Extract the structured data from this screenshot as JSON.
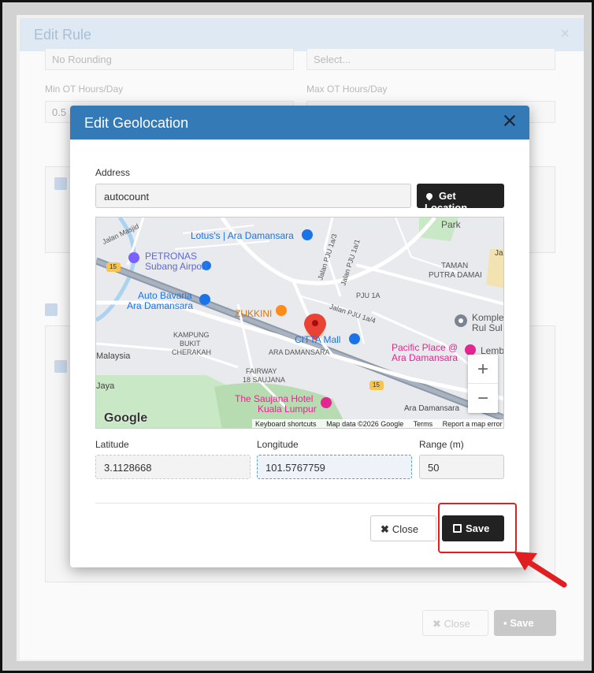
{
  "background": {
    "title": "Edit Rule",
    "rounding_select": "No Rounding",
    "select_placeholder": "Select...",
    "min_ot_label": "Min OT Hours/Day",
    "max_ot_label": "Max OT Hours/Day",
    "min_ot_value": "0.5",
    "close_label": "Close",
    "save_label": "Save"
  },
  "modal": {
    "title": "Edit Geolocation",
    "address_label": "Address",
    "address_value": "autocount",
    "get_location_label": "Get Location",
    "latitude_label": "Latitude",
    "latitude_value": "3.1128668",
    "longitude_label": "Longitude",
    "longitude_value": "101.5767759",
    "range_label": "Range (m)",
    "range_value": "50",
    "close_label": "Close",
    "save_label": "Save"
  },
  "map": {
    "places": {
      "lotus": "Lotus's | Ara Damansara",
      "petronas": "PETRONAS Subang Airport",
      "petronas_line2": "Subang Airport",
      "petronas_line1": "PETRONAS",
      "auto_bavaria_1": "Auto Bavaria",
      "auto_bavaria_2": "Ara Damansara",
      "zukkini": "ZUKKINI",
      "citta": "CITTA Mall",
      "pacific_1": "Pacific Place @",
      "pacific_2": "Ara Damansara",
      "saujana_1": "The Saujana Hotel",
      "saujana_2": "Kuala Lumpur",
      "taman_1": "TAMAN",
      "taman_2": "PUTRA DAMAI",
      "komplek_1": "Komple",
      "komplek_2": "Rul Sul",
      "lembah": "Lemb",
      "park": "Park",
      "kampung_1": "KAMPUNG",
      "kampung_2": "BUKIT",
      "kampung_3": "CHERAKAH",
      "ara_damansara": "ARA DAMANSARA",
      "fairway_1": "FAIRWAY",
      "fairway_2": "18 SAUJANA",
      "pju1a": "PJU 1A",
      "jalan_pju_1a3": "Jalan PJU 1a/3",
      "jalan_pju_1a1": "Jalan PJU 1a/1",
      "jalan_pju_1a4": "Jalan PJU 1a/4",
      "jalan_masjid": "Jalan Masjid",
      "malaysia": "Malaysia",
      "jaya": "Jaya",
      "ara_damansara_road": "Ara Damansara",
      "jal": "Jal",
      "route_15": "15"
    },
    "logo": "Google",
    "footer": {
      "shortcuts": "Keyboard shortcuts",
      "data": "Map data ©2026 Google",
      "terms": "Terms",
      "report": "Report a map error"
    },
    "zoom_in": "+",
    "zoom_out": "−"
  },
  "colors": {
    "modal_header": "#337ab7",
    "highlight": "#e02020",
    "button_dark": "#222222"
  }
}
